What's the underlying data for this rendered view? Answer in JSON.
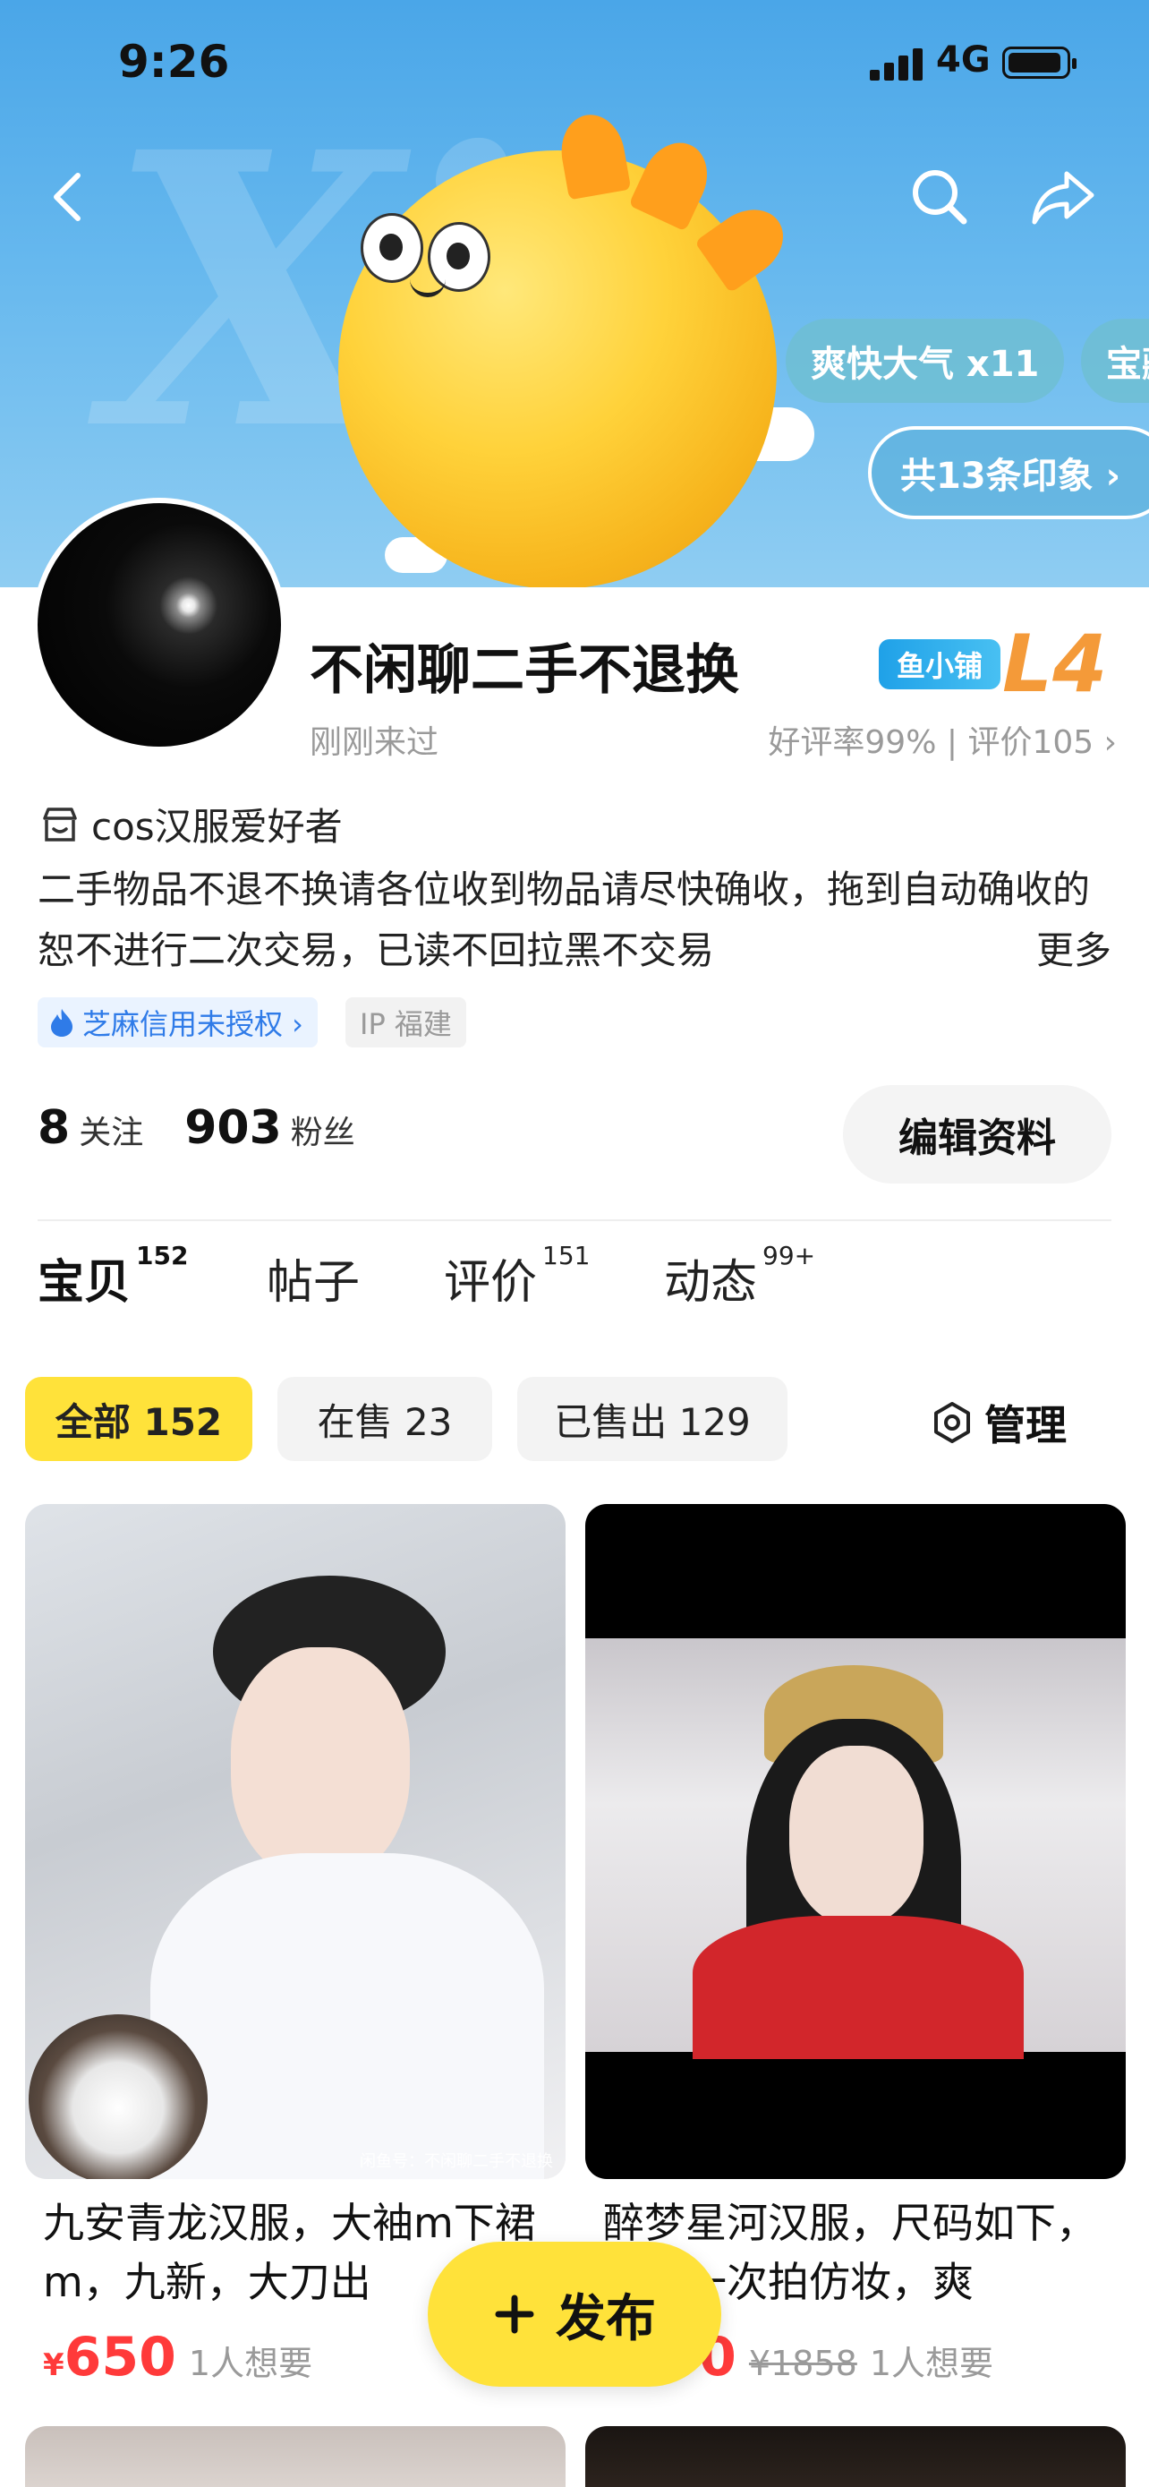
{
  "status_bar": {
    "time": "9:26",
    "network": "4G"
  },
  "header": {
    "tags": [
      "爽快大气 x11",
      "宝藏"
    ],
    "impressions_label": "共13条印象 ›"
  },
  "profile": {
    "username": "不闲聊二手不退换",
    "store_badge": "鱼小铺",
    "level": "L4",
    "last_seen": "刚刚来过",
    "rating": "好评率99% | 评价105 ›",
    "tagline": "cos汉服爱好者",
    "bio": "二手物品不退不换请各位收到物品请尽快确收，拖到自动确收的恕不进行二次交易，已读不回拉黑不交易",
    "bio_more": "更多",
    "credit": "芝麻信用未授权 ›",
    "ip": "IP 福建",
    "following_count": "8",
    "following_label": "关注",
    "followers_count": "903",
    "followers_label": "粉丝",
    "edit_label": "编辑资料"
  },
  "tabs": [
    {
      "label": "宝贝",
      "badge": "152"
    },
    {
      "label": "帖子",
      "badge": ""
    },
    {
      "label": "评价",
      "badge": "151"
    },
    {
      "label": "动态",
      "badge": "99+"
    }
  ],
  "filters": [
    {
      "label": "全部 152"
    },
    {
      "label": "在售 23"
    },
    {
      "label": "已售出 129"
    }
  ],
  "manage_label": "管理",
  "products": [
    {
      "title": "九安青龙汉服，大袖m下裙m，九新，大刀出",
      "currency": "¥",
      "price": "650",
      "original_price": "",
      "wants": "1人想要",
      "watermark": "闲鱼号：不闲聊二手不退换"
    },
    {
      "title": "醉梦星河汉服，尺码如下，穿过一次拍仿妆，爽",
      "currency": "¥",
      "price": "500",
      "original_price": "¥1858",
      "wants": "1人想要",
      "watermark": ""
    }
  ],
  "publish_label": "发布",
  "colors": {
    "accent": "#ffe23a",
    "price": "#ff3a3a",
    "level": "#f49a39",
    "banner": "#4aa6e8"
  }
}
